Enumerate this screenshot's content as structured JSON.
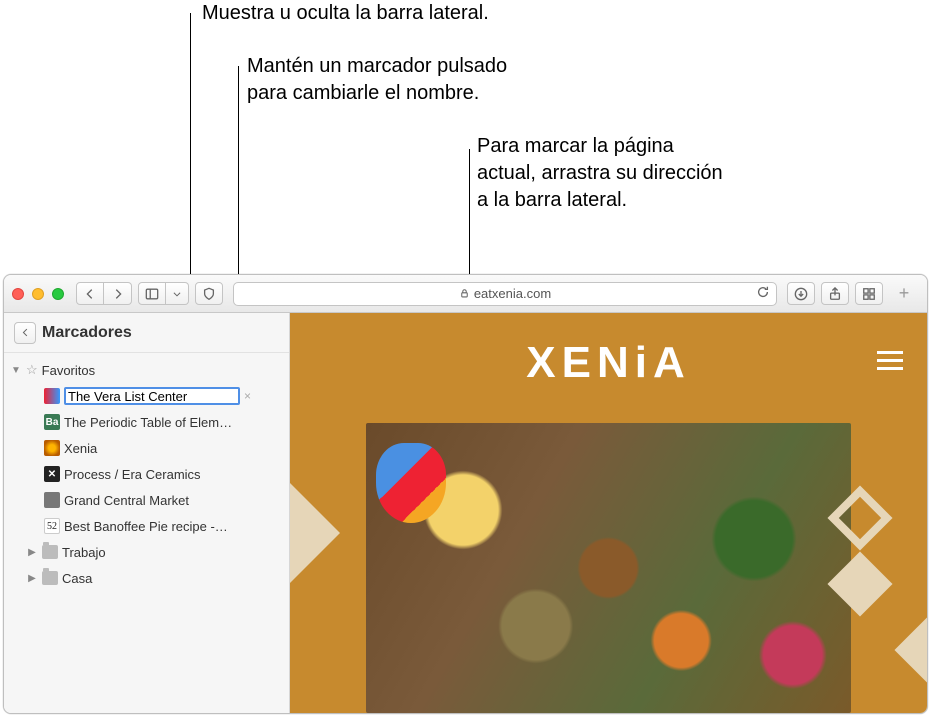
{
  "callouts": {
    "c1": "Muestra u oculta la barra lateral.",
    "c2a": "Mantén un marcador pulsado",
    "c2b": "para cambiarle el nombre.",
    "c3a": "Para marcar la página",
    "c3b": "actual, arrastra su dirección",
    "c3c": "a la barra lateral."
  },
  "url": "eatxenia.com",
  "sidebar": {
    "title": "Marcadores",
    "favorites_label": "Favoritos",
    "items": [
      {
        "label": "The Vera List Center",
        "editing": true
      },
      {
        "label": "The Periodic Table of Elem…"
      },
      {
        "label": "Xenia"
      },
      {
        "label": "Process / Era Ceramics"
      },
      {
        "label": "Grand Central Market"
      },
      {
        "label": "Best Banoffee Pie recipe -…"
      }
    ],
    "folders": [
      {
        "label": "Trabajo"
      },
      {
        "label": "Casa"
      }
    ]
  },
  "page": {
    "brand": "XENiA"
  }
}
